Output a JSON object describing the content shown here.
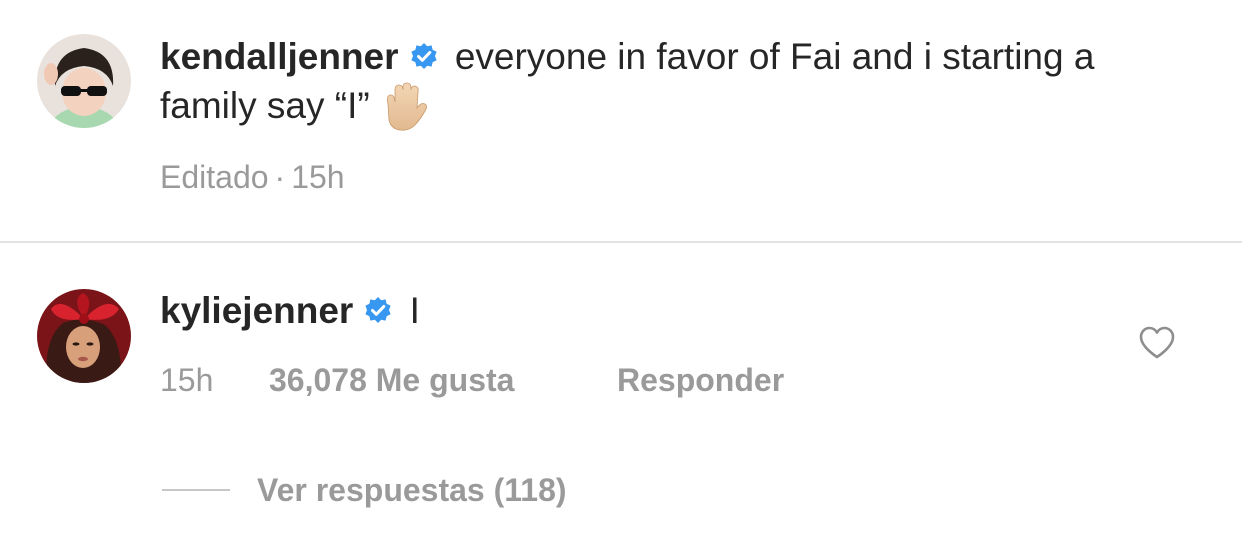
{
  "comments": [
    {
      "username": "kendalljenner",
      "verified": true,
      "text": "everyone in favor of Fai and i starting a family say “I”",
      "emoji": "raised-hand-icon",
      "edited_label": "Editado",
      "separator": "·",
      "time": "15h"
    },
    {
      "username": "kyliejenner",
      "verified": true,
      "text": "I",
      "time": "15h",
      "likes": "36,078 Me gusta",
      "reply_label": "Responder",
      "view_replies": "Ver respuestas (118)"
    }
  ],
  "colors": {
    "verified_blue": "#3897f0",
    "text": "#262626",
    "secondary_text": "#9a9a9a",
    "divider": "#e3e3e3"
  },
  "icons": {
    "verified": "verified-badge-icon",
    "like": "heart-outline-icon"
  }
}
